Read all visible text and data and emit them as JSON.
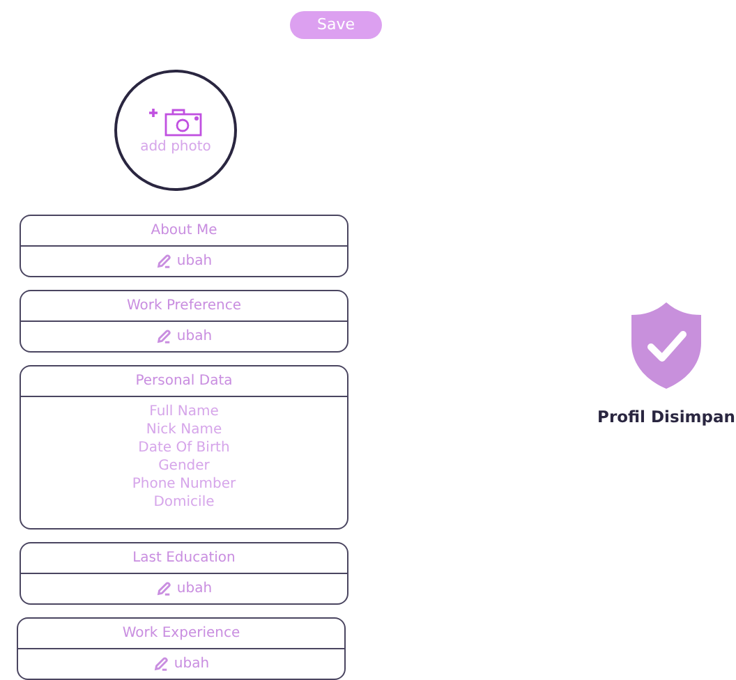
{
  "save_button": {
    "label": "Save"
  },
  "photo": {
    "label": "add photo"
  },
  "sections": [
    {
      "kind": "edit",
      "title": "About Me",
      "action": "ubah"
    },
    {
      "kind": "edit",
      "title": "Work Preference",
      "action": "ubah"
    },
    {
      "kind": "list",
      "title": "Personal Data",
      "items": [
        "Full Name",
        "Nick Name",
        "Date Of Birth",
        "Gender",
        "Phone Number",
        "Domicile"
      ]
    },
    {
      "kind": "edit",
      "title": "Last Education",
      "action": "ubah"
    },
    {
      "kind": "edit",
      "title": "Work Experience",
      "action": "ubah"
    }
  ],
  "status": {
    "message": "Profil Disimpan"
  }
}
